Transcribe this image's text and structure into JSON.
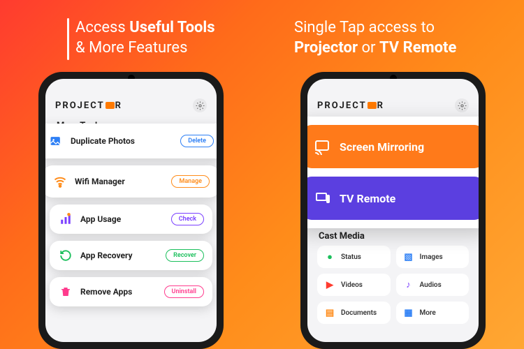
{
  "panel1": {
    "headline_prefix": "Access ",
    "headline_bold": "Useful Tools",
    "headline_line2": "& More Features",
    "brand": "PROJECT",
    "brand_suffix": "R",
    "section": "More Tools",
    "tools": [
      {
        "label": "Duplicate Photos",
        "btn": "Delete"
      },
      {
        "label": "Wifi Manager",
        "btn": "Manage"
      },
      {
        "label": "App Usage",
        "btn": "Check"
      },
      {
        "label": "App Recovery",
        "btn": "Recover"
      },
      {
        "label": "Remove Apps",
        "btn": "Uninstall"
      }
    ]
  },
  "panel2": {
    "headline_prefix": "Single Tap access to",
    "headline_bold1": "Projector",
    "headline_mid": " or ",
    "headline_bold2": "TV Remote",
    "brand": "PROJECT",
    "brand_suffix": "R",
    "hero": [
      {
        "label": "Screen Mirroring"
      },
      {
        "label": "TV Remote"
      }
    ],
    "cast_title": "Cast Media",
    "grid": [
      {
        "label": "Status"
      },
      {
        "label": "Images"
      },
      {
        "label": "Videos"
      },
      {
        "label": "Audios"
      },
      {
        "label": "Documents"
      },
      {
        "label": "More"
      }
    ]
  }
}
